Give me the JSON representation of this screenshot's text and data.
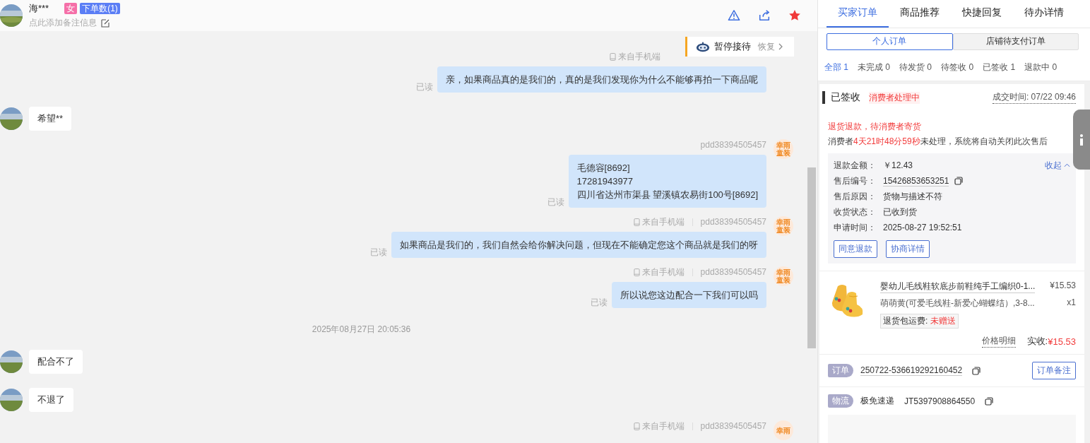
{
  "header": {
    "name": "海***",
    "gender": "女",
    "order_count": "下单数(1)",
    "remark_placeholder": "点此添加备注信息"
  },
  "overlay": {
    "label": "暂停接待",
    "action": "恢复"
  },
  "messages": [
    {
      "kind": "agent",
      "source": "来自手机端",
      "lines": [
        "亲，如果商品真的是我们的，真的是我们发现你为什么不能够再拍一下商品呢"
      ],
      "read": "已读"
    },
    {
      "kind": "customer",
      "lines": [
        "希望**"
      ]
    },
    {
      "kind": "agent",
      "agent_id": "pdd38394505457",
      "avatar_text": "幸雨童装",
      "lines": [
        "毛德容[8692]",
        "17281943977",
        "四川省达州市渠县 望溪镇农易街100号[8692]"
      ],
      "read": "已读"
    },
    {
      "kind": "agent",
      "source": "来自手机端",
      "agent_id": "pdd38394505457",
      "avatar_text": "幸雨童装",
      "lines": [
        "如果商品是我们的，我们自然会给你解决问题，但现在不能确定您这个商品就是我们的呀"
      ],
      "read": "已读"
    },
    {
      "kind": "agent",
      "source": "来自手机端",
      "agent_id": "pdd38394505457",
      "avatar_text": "幸雨童装",
      "lines": [
        "所以说您这边配合一下我们可以吗"
      ],
      "read": "已读"
    },
    {
      "kind": "time",
      "text": "2025年08月27日 20:05:36"
    },
    {
      "kind": "customer",
      "lines": [
        "配合不了"
      ]
    },
    {
      "kind": "customer",
      "lines": [
        "不退了"
      ]
    },
    {
      "kind": "agent",
      "source": "来自手机端",
      "agent_id": "pdd38394505457",
      "avatar_text": "幸雨"
    }
  ],
  "tabs": [
    {
      "label": "买家订单",
      "selected": true
    },
    {
      "label": "商品推荐",
      "selected": false
    },
    {
      "label": "快捷回复",
      "selected": false
    },
    {
      "label": "待办详情",
      "selected": false
    }
  ],
  "segments": [
    {
      "label": "个人订单",
      "selected": true
    },
    {
      "label": "店铺待支付订单",
      "selected": false
    }
  ],
  "filters": [
    {
      "label": "全部",
      "count": "1",
      "selected": true
    },
    {
      "label": "未完成",
      "count": "0",
      "selected": false
    },
    {
      "label": "待发货",
      "count": "0",
      "selected": false
    },
    {
      "label": "待签收",
      "count": "0",
      "selected": false
    },
    {
      "label": "已签收",
      "count": "1",
      "selected": false
    },
    {
      "label": "退款中",
      "count": "0",
      "selected": false
    }
  ],
  "order": {
    "status": "已签收",
    "tag": "消费者处理中",
    "deal_time": "成交时间: 07/22 09:46",
    "notice": "退货退款，待消费者寄货",
    "countdown": {
      "prefix": "消费者",
      "time": "4天21时48分59秒",
      "suffix": "未处理，系统将自动关闭此次售后"
    },
    "details": {
      "toggle": "收起",
      "rows": [
        {
          "label": "退款金额：",
          "value": "￥12.43",
          "kind": "amount"
        },
        {
          "label": "售后编号：",
          "value": "15426853653251",
          "kind": "copy"
        },
        {
          "label": "售后原因：",
          "value": "货物与描述不符",
          "kind": "plain"
        },
        {
          "label": "收货状态：",
          "value": "已收到货",
          "kind": "plain"
        },
        {
          "label": "申请时间：",
          "value": "2025-08-27 19:52:51",
          "kind": "plain"
        }
      ],
      "buttons": [
        "同意退款",
        "协商详情"
      ]
    },
    "product": {
      "kind": "picture",
      "title": "婴幼儿毛线鞋软底步前鞋纯手工编织0-1...",
      "spec": "萌萌黄(可爱毛线鞋-新爱心蝴蝶结）,3-8...",
      "price": "¥15.53",
      "quantity": "x1",
      "shipping_label": "退货包运费:",
      "shipping_value": "未赠送",
      "price_detail": "价格明细",
      "paid_label": "实收:",
      "paid_value": "¥15.53"
    },
    "order_row": {
      "tag": "订单",
      "number": "250722-536619292160452",
      "button": "订单备注"
    },
    "logistics": {
      "tag": "物流",
      "carrier": "极免速递",
      "tracking": "JT5397908864550"
    }
  }
}
